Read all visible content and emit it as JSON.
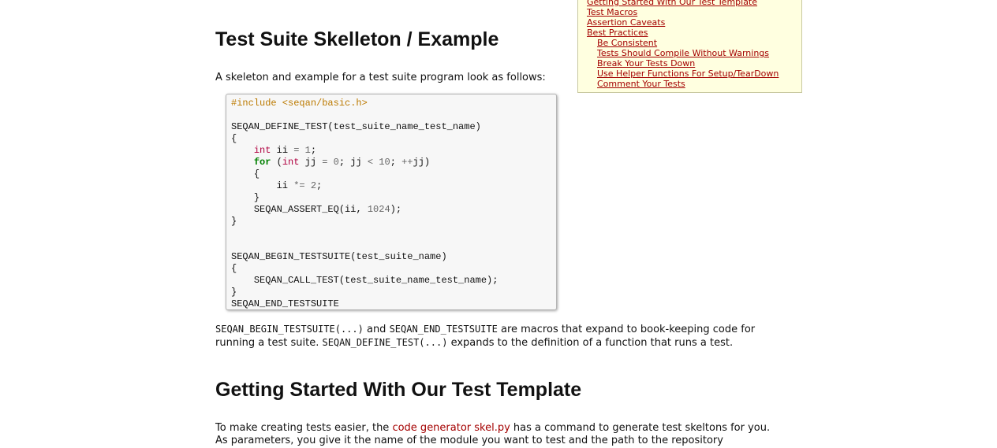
{
  "toc": {
    "items": [
      {
        "label": "Getting Started With Our Test Template",
        "level": 1
      },
      {
        "label": "Test Macros",
        "level": 1
      },
      {
        "label": "Assertion Caveats",
        "level": 1
      },
      {
        "label": "Best Practices",
        "level": 1
      },
      {
        "label": "Be Consistent",
        "level": 2
      },
      {
        "label": "Tests Should Compile Without Warnings",
        "level": 2
      },
      {
        "label": "Break Your Tests Down",
        "level": 2
      },
      {
        "label": "Use Helper Functions For Setup/TearDown",
        "level": 2
      },
      {
        "label": "Comment Your Tests",
        "level": 2
      }
    ]
  },
  "section1": {
    "title": "Test Suite Skelleton / Example",
    "intro": "A skeleton and example for a test suite program look as follows:"
  },
  "code": {
    "include": "#include <seqan/basic.h>",
    "define_test": "SEQAN_DEFINE_TEST(test_suite_name_test_name)",
    "open_brace": "{",
    "close_brace": "}",
    "int_kw": "int",
    "for_kw": "for",
    "var_ii": "ii",
    "var_jj": "jj",
    "assign": "=",
    "lt": "<",
    "inc": "++",
    "mul_assign": "*=",
    "num_1": "1",
    "num_0": "0",
    "num_10": "10",
    "num_2": "2",
    "num_1024": "1024",
    "assert": "SEQAN_ASSERT_EQ",
    "begin_suite": "SEQAN_BEGIN_TESTSUITE(test_suite_name)",
    "call_test": "SEQAN_CALL_TEST(test_suite_name_test_name);",
    "end_suite": "SEQAN_END_TESTSUITE"
  },
  "after_code": {
    "macro1": "SEQAN_BEGIN_TESTSUITE(...)",
    "and": " and ",
    "macro2": "SEQAN_END_TESTSUITE",
    "text1": " are macros that expand to book-keeping code for running a test suite. ",
    "macro3": "SEQAN_DEFINE_TEST(...)",
    "text2": " expands to the definition of a function that runs a test."
  },
  "section2": {
    "title": "Getting Started With Our Test Template",
    "text_before": "To make creating tests easier, the ",
    "link": "code generator skel.py",
    "text_after": " has a command to generate test skeltons for you. As parameters, you give it the name of the module you want to test and the path to the repository"
  }
}
